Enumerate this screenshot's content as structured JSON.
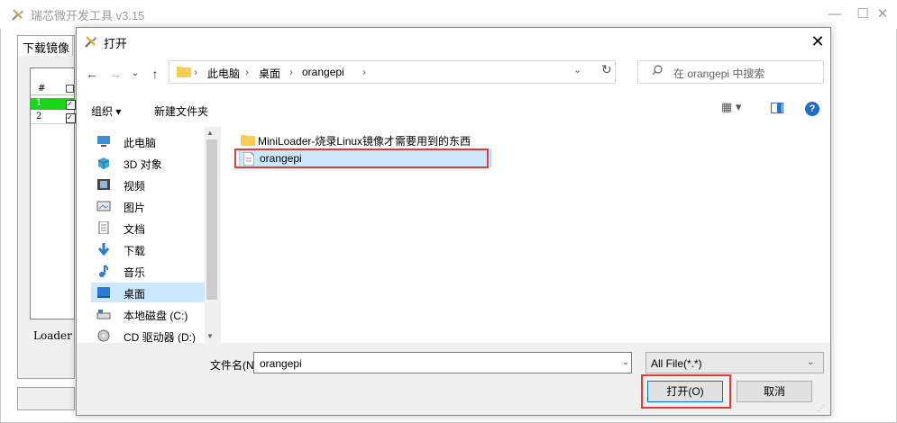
{
  "background_app": {
    "title": "瑞芯微开发工具 v3.15",
    "tab_label": "下载镜像",
    "grid_header": "#",
    "rows": [
      "1",
      "2"
    ],
    "loader_label": "Loader"
  },
  "dialog": {
    "title": "打开",
    "address": {
      "crumbs": [
        "此电脑",
        "桌面",
        "orangepi"
      ]
    },
    "search": {
      "placeholder": "在 orangepi 中搜索"
    },
    "toolbar": {
      "organize": "组织 ▾",
      "new_folder": "新建文件夹"
    },
    "nav_items": [
      {
        "label": "此电脑",
        "icon": "computer-icon"
      },
      {
        "label": "3D 对象",
        "icon": "cube-icon"
      },
      {
        "label": "视频",
        "icon": "video-icon"
      },
      {
        "label": "图片",
        "icon": "picture-icon"
      },
      {
        "label": "文档",
        "icon": "document-icon"
      },
      {
        "label": "下载",
        "icon": "download-icon"
      },
      {
        "label": "音乐",
        "icon": "music-icon"
      },
      {
        "label": "桌面",
        "icon": "desktop-icon",
        "selected": true
      },
      {
        "label": "本地磁盘 (C:)",
        "icon": "drive-icon"
      },
      {
        "label": "CD 驱动器 (D:)",
        "icon": "cd-icon"
      }
    ],
    "files": [
      {
        "name": "MiniLoader-烧录Linux镜像才需要用到的东西",
        "type": "folder"
      },
      {
        "name": "orangepi",
        "type": "file",
        "selected": true
      }
    ],
    "filename_label": "文件名(N):",
    "filename_value": "orangepi",
    "filetype_value": "All File(*.*)",
    "open_button": "打开(O)",
    "cancel_button": "取消"
  },
  "colors": {
    "highlight_red": "#e53935",
    "selection_blue": "#cce8ff",
    "folder_yellow": "#f8cd52"
  }
}
